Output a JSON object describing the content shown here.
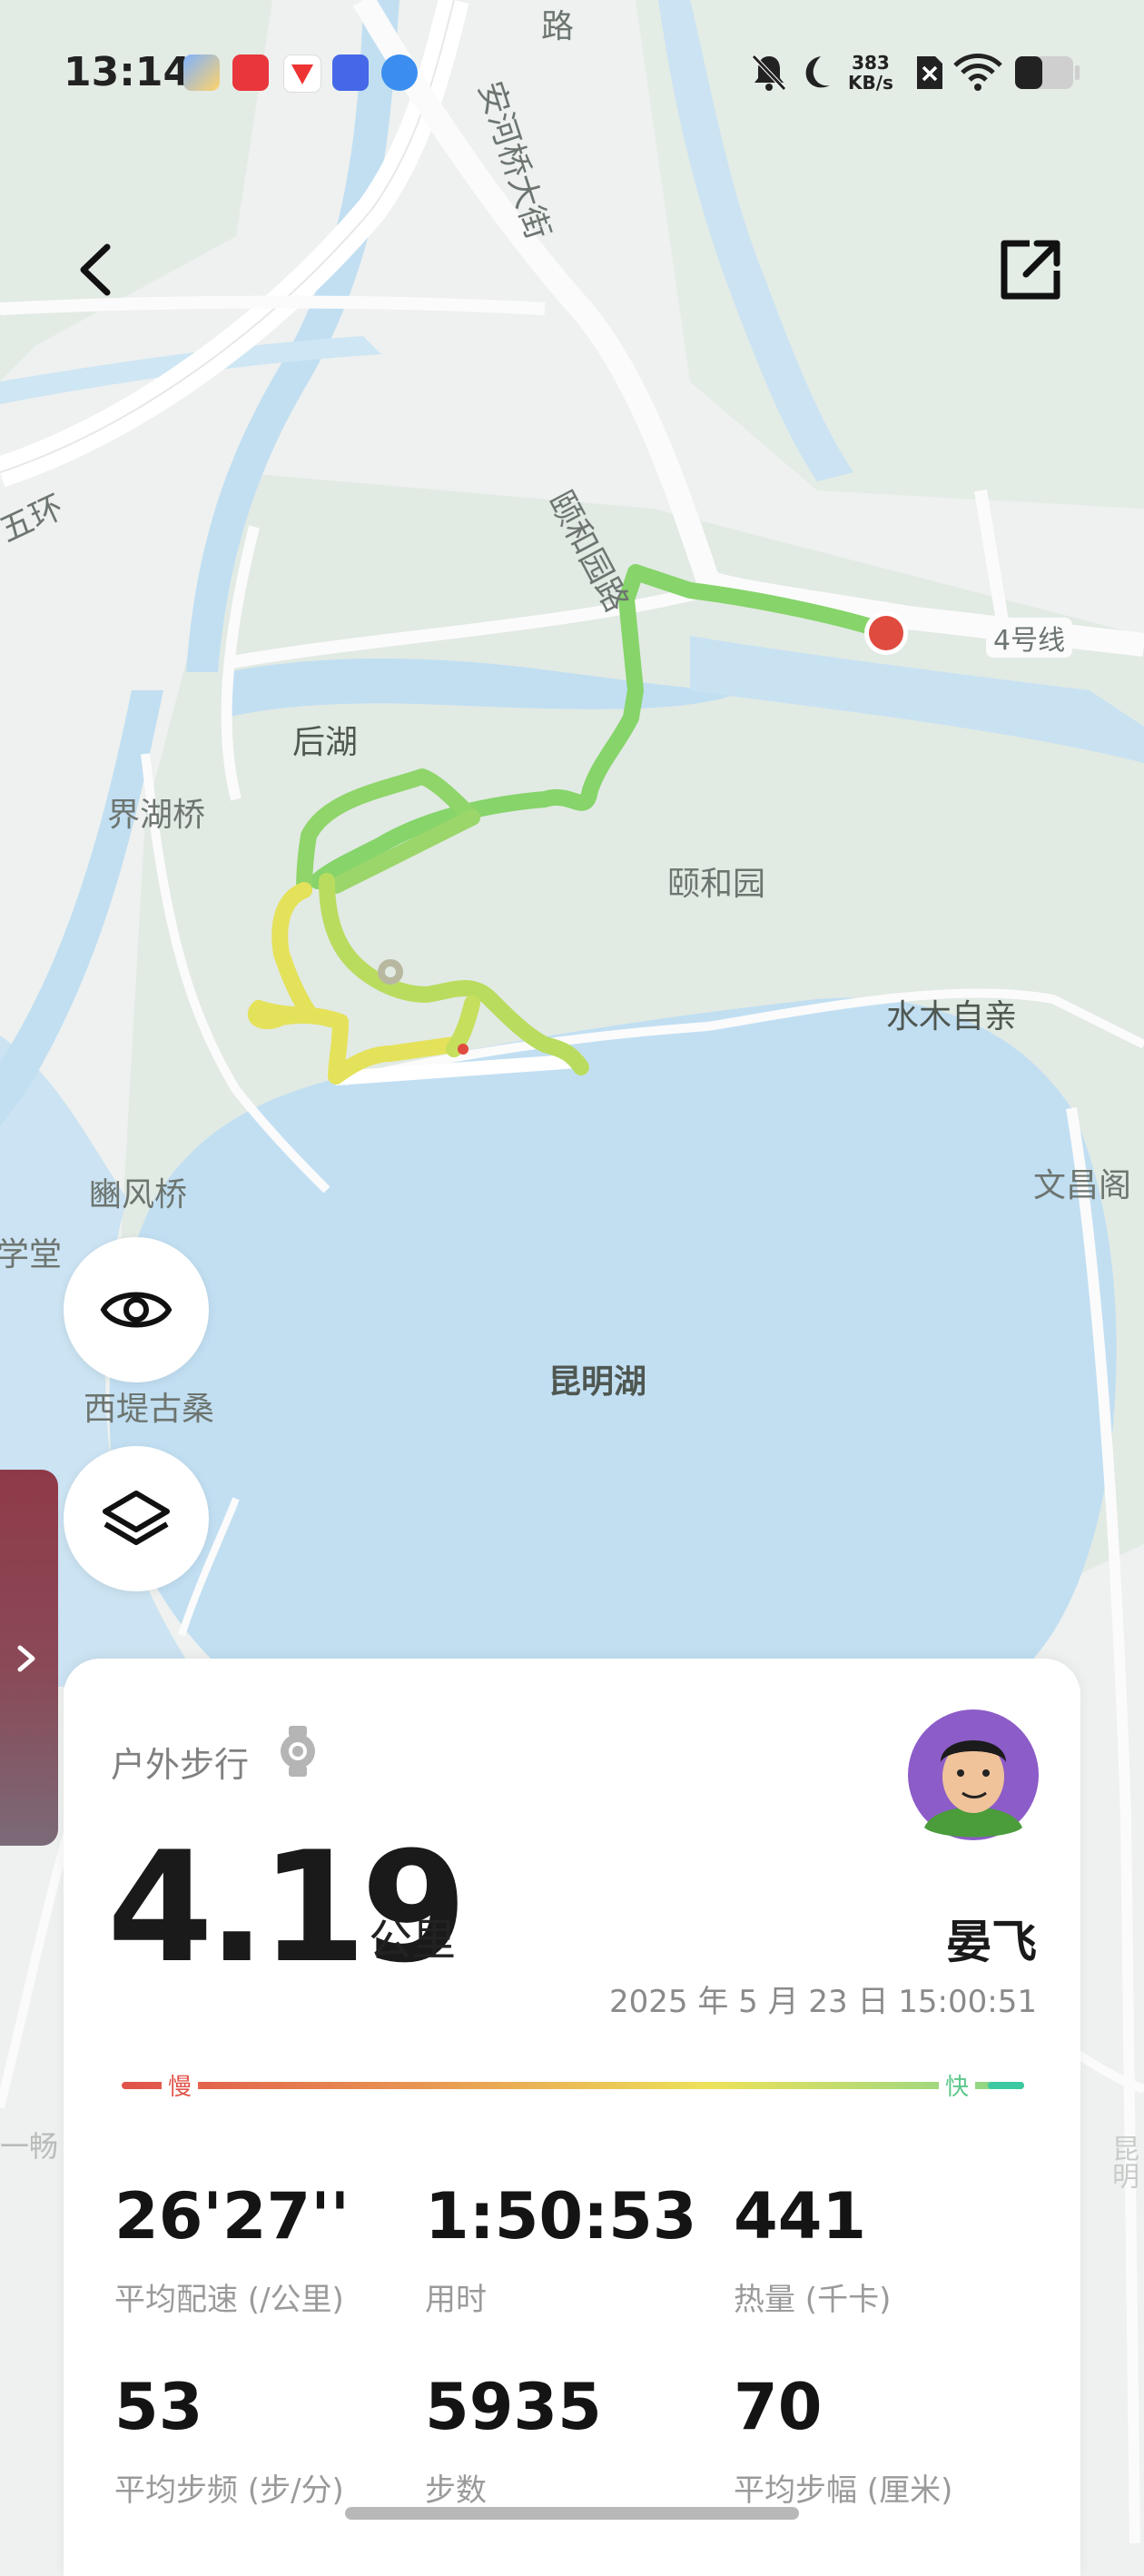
{
  "status_bar": {
    "time": "13:14",
    "net_speed": "383",
    "net_unit": "KB/s",
    "app_icons": [
      "app-blue-icon",
      "xiaohongshu-icon",
      "send-icon",
      "vivo-icon",
      "browser-icon"
    ]
  },
  "map": {
    "labels": {
      "houhu": "后湖",
      "jiehuqiao": "界湖桥",
      "yiheyuan": "颐和园",
      "shuimuziqin": "水木自亲",
      "wenchangge": "文昌阁",
      "binfengqiao": "豳风桥",
      "xuetang": "学堂",
      "xidigusang": "西堤古桑",
      "kunminghu": "昆明湖",
      "yiheyuanlu": "颐和园路",
      "anheqiaodajie": "安河桥大街",
      "line4": "4号线",
      "wuhuan": "五环",
      "lu": "路",
      "changchun": "一畅",
      "ming": "昆明"
    }
  },
  "card": {
    "activity": "户外步行",
    "distance": "4.19",
    "unit": "公里",
    "user_name": "晏飞",
    "datetime": "2025 年 5 月 23 日 15:00:51",
    "legend_slow": "慢",
    "legend_fast": "快",
    "stats": [
      {
        "value": "26'27''",
        "label": "平均配速 (/公里)"
      },
      {
        "value": "1:50:53",
        "label": "用时"
      },
      {
        "value": "441",
        "label": "热量 (千卡)"
      },
      {
        "value": "53",
        "label": "平均步频 (步/分)"
      },
      {
        "value": "5935",
        "label": "步数"
      },
      {
        "value": "70",
        "label": "平均步幅 (厘米)"
      }
    ]
  },
  "colors": {
    "water": "#c2dff2",
    "park": "#e3ebe6",
    "track_green": "#86d46a",
    "track_yellow": "#e4e25a",
    "end_marker": "#e04b3f"
  }
}
